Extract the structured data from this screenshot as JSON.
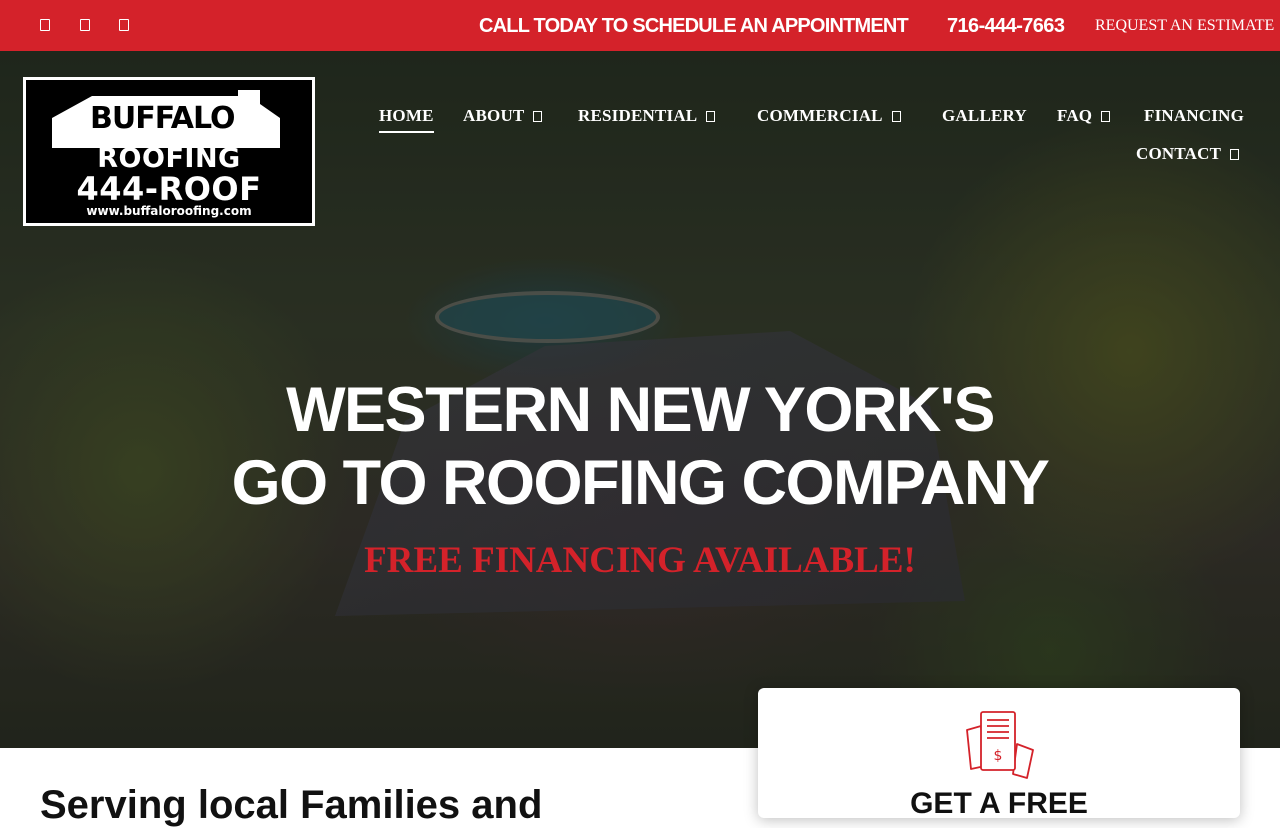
{
  "topbar": {
    "social": [
      {
        "name": "facebook-icon"
      },
      {
        "name": "twitter-icon"
      },
      {
        "name": "instagram-icon"
      }
    ],
    "cta_text": "CALL TODAY TO SCHEDULE AN APPOINTMENT",
    "phone": "716-444-7663",
    "estimate_link": "REQUEST AN ESTIMATE"
  },
  "logo": {
    "line1": "BUFFALO",
    "line2": "ROOFING",
    "line3": "444-ROOF",
    "line4": "www.buffaloroofing.com"
  },
  "nav": {
    "items": [
      {
        "label": "HOME",
        "active": true
      },
      {
        "label": "ABOUT",
        "dropdown": true
      },
      {
        "label": "RESIDENTIAL",
        "dropdown": true
      },
      {
        "label": "COMMERCIAL",
        "dropdown": true
      },
      {
        "label": "GALLERY"
      },
      {
        "label": "FAQ",
        "dropdown": true
      },
      {
        "label": "FINANCING"
      },
      {
        "label": "CONTACT",
        "dropdown": true
      }
    ]
  },
  "hero": {
    "headline_line1": "WESTERN NEW YORK'S",
    "headline_line2": "GO TO ROOFING COMPANY",
    "subheadline": "FREE FINANCING AVAILABLE!"
  },
  "content": {
    "section_title_partial": "Serving local Families and"
  },
  "card": {
    "icon": "invoice-dollar-icon",
    "title_partial": "GET A FREE"
  },
  "colors": {
    "brand_red": "#d4222a",
    "white": "#ffffff",
    "black": "#000000"
  }
}
